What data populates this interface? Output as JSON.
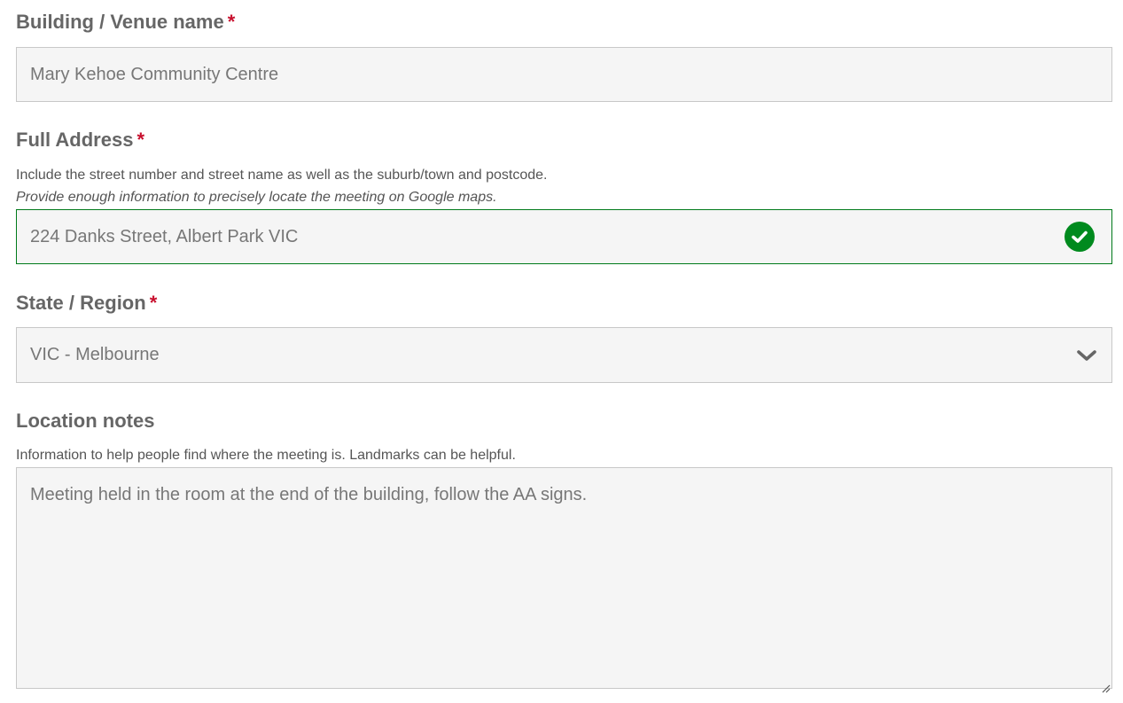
{
  "venue": {
    "label": "Building / Venue name",
    "required_mark": "*",
    "value": "Mary Kehoe Community Centre"
  },
  "address": {
    "label": "Full Address",
    "required_mark": "*",
    "help_line1": "Include the street number and street name as well as the suburb/town and postcode.",
    "help_line2": "Provide enough information to precisely locate the meeting on Google maps.",
    "value": "224 Danks Street, Albert Park VIC",
    "status_icon": "check-circle-icon",
    "status_color": "#008a1e"
  },
  "region": {
    "label": "State / Region",
    "required_mark": "*",
    "selected": "VIC - Melbourne",
    "icon": "chevron-down-icon"
  },
  "notes": {
    "label": "Location notes",
    "help": "Information to help people find where the meeting is. Landmarks can be helpful.",
    "value": "Meeting held in the room at the end of the building, follow the AA signs."
  },
  "colors": {
    "required": "#c8102e",
    "valid_border": "#007a1a",
    "field_bg": "#f5f5f5"
  }
}
